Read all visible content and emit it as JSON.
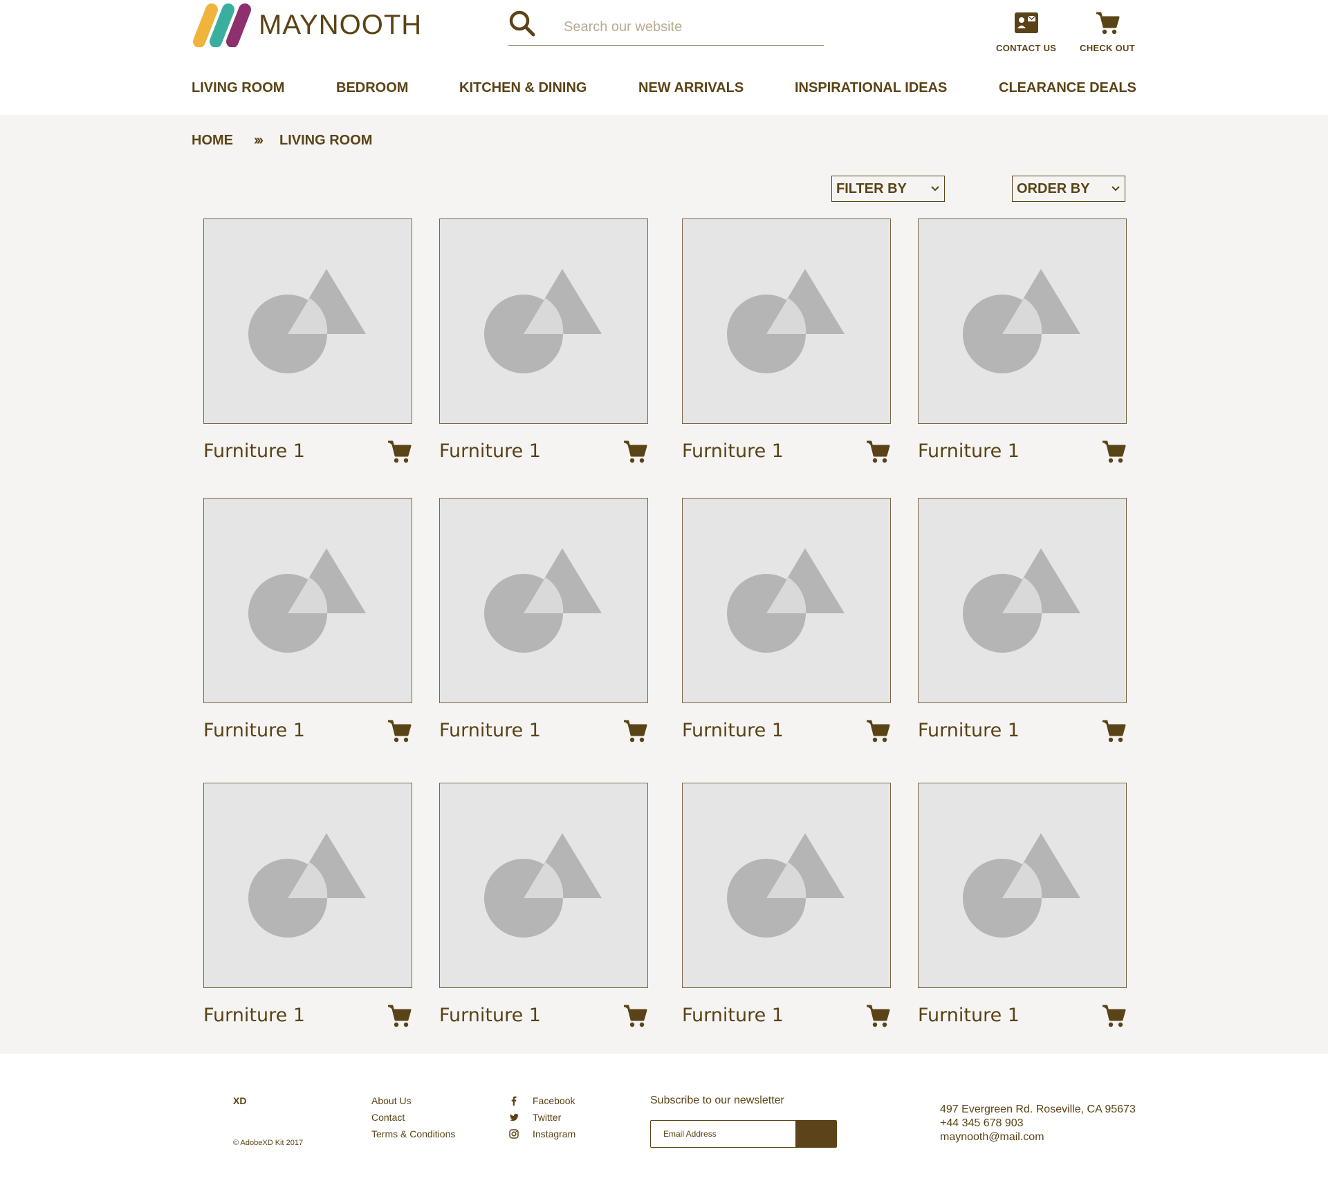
{
  "brand": {
    "name": "MAYNOOTH",
    "logo_colors": [
      "#f0b43c",
      "#3aaf9f",
      "#8e2f6e"
    ]
  },
  "search": {
    "placeholder": "Search our website"
  },
  "top_actions": {
    "contact_label": "CONTACT US",
    "checkout_label": "CHECK OUT"
  },
  "nav": [
    "LIVING ROOM",
    "BEDROOM",
    "KITCHEN & DINING",
    "NEW ARRIVALS",
    "INSPIRATIONAL IDEAS",
    "CLEARANCE DEALS"
  ],
  "breadcrumb": {
    "home": "HOME",
    "separator": "›››",
    "current": "LIVING ROOM"
  },
  "controls": {
    "filter_label": "FILTER BY",
    "order_label": "ORDER BY"
  },
  "products": [
    {
      "name": "Furniture 1"
    },
    {
      "name": "Furniture 1"
    },
    {
      "name": "Furniture 1"
    },
    {
      "name": "Furniture 1"
    },
    {
      "name": "Furniture 1"
    },
    {
      "name": "Furniture 1"
    },
    {
      "name": "Furniture 1"
    },
    {
      "name": "Furniture 1"
    },
    {
      "name": "Furniture 1"
    },
    {
      "name": "Furniture 1"
    },
    {
      "name": "Furniture 1"
    },
    {
      "name": "Furniture 1"
    }
  ],
  "footer": {
    "brand": "XD",
    "copyright": "© AdobeXD Kit 2017",
    "links": [
      "About Us",
      "Contact",
      "Terms & Conditions"
    ],
    "social": [
      {
        "label": "Facebook",
        "icon": "facebook-icon"
      },
      {
        "label": "Twitter",
        "icon": "twitter-icon"
      },
      {
        "label": "Instagram",
        "icon": "instagram-icon"
      }
    ],
    "newsletter_label": "Subscribe to our newsletter",
    "email_placeholder": "Email Address",
    "address": "497 Evergreen Rd. Roseville, CA 95673",
    "phone": "+44 345 678 903",
    "email": "maynooth@mail.com"
  },
  "colors": {
    "primary": "#5a4316",
    "background": "#f5f4f2",
    "placeholder": "#e5e5e5",
    "placeholder_shape": "#b5b5b5"
  }
}
